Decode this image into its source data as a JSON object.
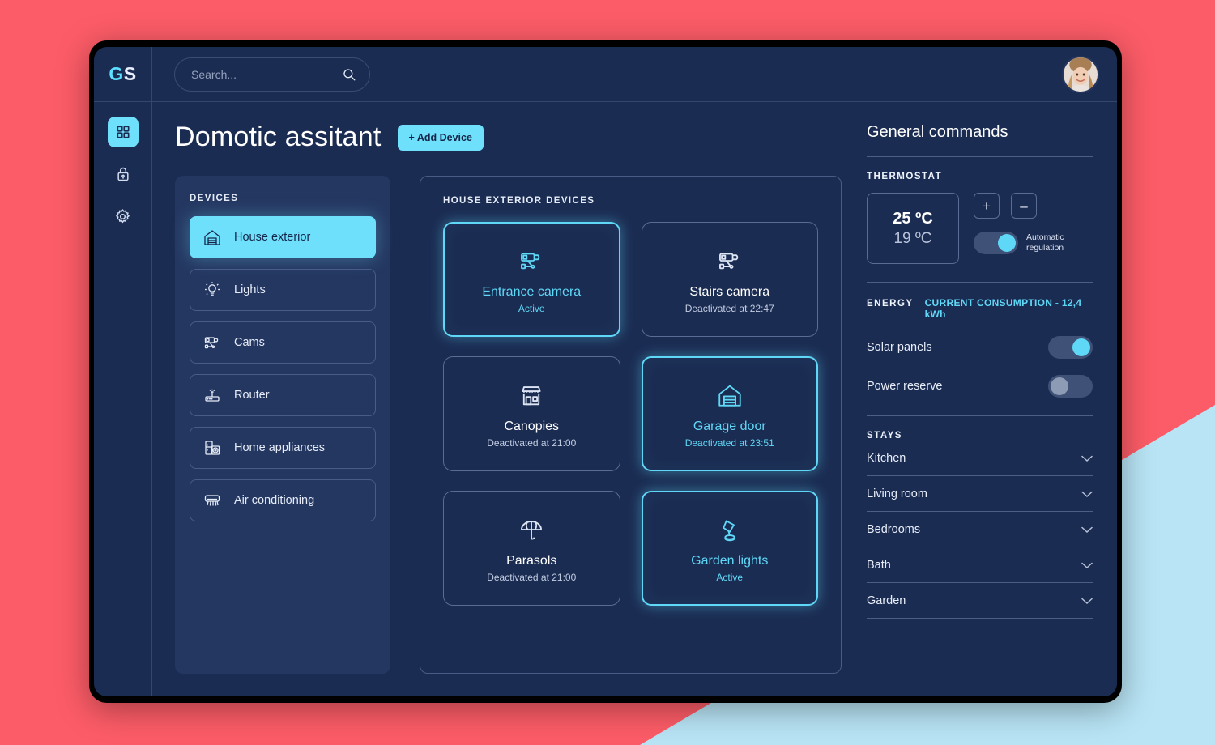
{
  "theme": {
    "backdrop_pink": "#fc5c67",
    "backdrop_blue": "#b8e4f5",
    "screen_bg": "#1b2c52",
    "panel_bg": "#243761",
    "accent_cyan": "#6fe0fb",
    "border": "#4a5c85"
  },
  "topbar": {
    "logo_primary": "G",
    "logo_secondary": "S",
    "search_placeholder": "Search...",
    "search_value": "",
    "search_icon": "search-icon",
    "avatar_alt": "User avatar"
  },
  "rail": {
    "items": [
      {
        "icon": "grid-icon",
        "active": true
      },
      {
        "icon": "lock-icon",
        "active": false
      },
      {
        "icon": "gear-icon",
        "active": false
      }
    ]
  },
  "page": {
    "title": "Domotic assitant",
    "add_device_label": "+ Add Device"
  },
  "devices_panel": {
    "label": "DEVICES",
    "items": [
      {
        "label": "House exterior",
        "icon": "garage-icon",
        "active": true
      },
      {
        "label": "Lights",
        "icon": "bulb-icon",
        "active": false
      },
      {
        "label": "Cams",
        "icon": "camera-icon",
        "active": false
      },
      {
        "label": "Router",
        "icon": "router-icon",
        "active": false
      },
      {
        "label": "Home appliances",
        "icon": "appliances-icon",
        "active": false
      },
      {
        "label": "Air conditioning",
        "icon": "ac-icon",
        "active": false
      }
    ]
  },
  "house_panel": {
    "title": "HOUSE EXTERIOR DEVICES",
    "cards": [
      {
        "name": "Entrance camera",
        "status": "Active",
        "icon": "camera-icon",
        "on": true
      },
      {
        "name": "Stairs camera",
        "status": "Deactivated at 22:47",
        "icon": "camera-icon",
        "on": false
      },
      {
        "name": "Canopies",
        "status": "Deactivated at 21:00",
        "icon": "canopy-icon",
        "on": false
      },
      {
        "name": "Garage door",
        "status": "Deactivated at 23:51",
        "icon": "garage-icon",
        "on": true
      },
      {
        "name": "Parasols",
        "status": "Deactivated at 21:00",
        "icon": "parasol-icon",
        "on": false
      },
      {
        "name": "Garden lights",
        "status": "Active",
        "icon": "gardenlight-icon",
        "on": true
      }
    ]
  },
  "right_panel": {
    "title": "General commands",
    "thermostat": {
      "section_label": "THERMOSTAT",
      "target_temp": "25 ºC",
      "current_temp": "19 ºC",
      "increase_label": "+",
      "decrease_label": "–",
      "auto_label_line1": "Automatic",
      "auto_label_line2": "regulation",
      "auto_on": true
    },
    "energy": {
      "section_label": "ENERGY",
      "consumption": "CURRENT CONSUMPTION - 12,4 kWh",
      "switches": [
        {
          "label": "Solar panels",
          "on": true
        },
        {
          "label": "Power reserve",
          "on": false
        }
      ]
    },
    "stays": {
      "section_label": "STAYS",
      "items": [
        {
          "label": "Kitchen"
        },
        {
          "label": "Living room"
        },
        {
          "label": "Bedrooms"
        },
        {
          "label": "Bath"
        },
        {
          "label": "Garden"
        }
      ]
    }
  }
}
